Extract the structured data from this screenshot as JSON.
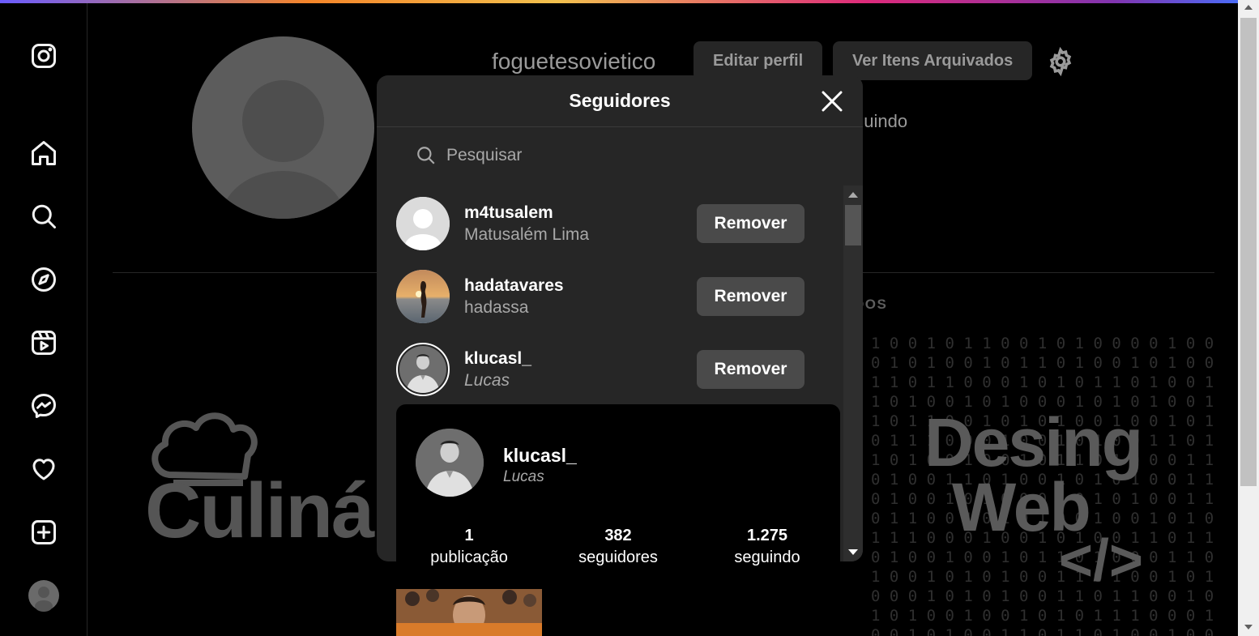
{
  "app": {
    "accent_gradient": [
      "#6a5cff",
      "#f58529",
      "#dd2a7b",
      "#8134af"
    ]
  },
  "sidebar": {
    "items": [
      {
        "icon": "instagram-logo-icon"
      },
      {
        "icon": "home-icon"
      },
      {
        "icon": "search-icon"
      },
      {
        "icon": "explore-compass-icon"
      },
      {
        "icon": "reels-icon"
      },
      {
        "icon": "messenger-icon"
      },
      {
        "icon": "heart-icon"
      },
      {
        "icon": "create-plus-icon"
      },
      {
        "icon": "profile-avatar-icon"
      }
    ]
  },
  "profile": {
    "username": "foguetesovietico",
    "edit_button": "Editar perfil",
    "archive_button": "Ver Itens Arquivados",
    "seguindo_partial": "guindo",
    "tab_partial": "DOS",
    "post1_text": "Culinár",
    "post2_line1": "Desing",
    "post2_line2": "Web",
    "post2_tag": "</>"
  },
  "modal": {
    "title": "Seguidores",
    "search_placeholder": "Pesquisar",
    "followers": [
      {
        "username": "m4tusalem",
        "name": "Matusalém Lima",
        "button": "Remover"
      },
      {
        "username": "hadatavares",
        "name": "hadassa",
        "button": "Remover"
      },
      {
        "username": "klucasl_",
        "name": "Lucas",
        "button": "Remover"
      }
    ]
  },
  "hover_card": {
    "username": "klucasl_",
    "name": "Lucas",
    "stats": [
      {
        "value": "1",
        "label": "publicação"
      },
      {
        "value": "382",
        "label": "seguidores"
      },
      {
        "value": "1.275",
        "label": "seguindo"
      }
    ]
  }
}
